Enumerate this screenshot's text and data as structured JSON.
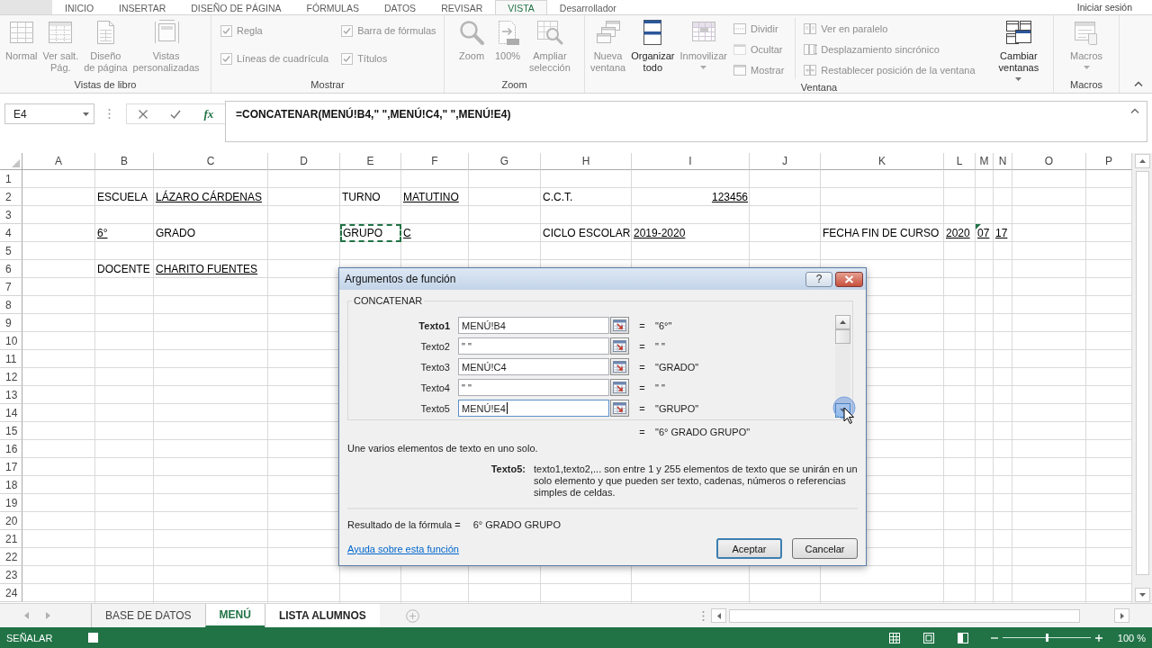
{
  "ribbon_tabs": [
    {
      "label": "INICIO",
      "selected": false
    },
    {
      "label": "INSERTAR",
      "selected": false
    },
    {
      "label": "DISEÑO DE PÁGINA",
      "selected": false
    },
    {
      "label": "FÓRMULAS",
      "selected": false
    },
    {
      "label": "DATOS",
      "selected": false
    },
    {
      "label": "REVISAR",
      "selected": false
    },
    {
      "label": "VISTA",
      "selected": true
    },
    {
      "label": "Desarrollador",
      "selected": false
    }
  ],
  "account": "Iniciar sesión",
  "ribbon_groups": [
    {
      "label": "Vistas de libro",
      "items": [
        {
          "kind": "large",
          "label": "Normal",
          "disabled": true,
          "dropdown": false
        },
        {
          "kind": "large",
          "label": "Ver salt.\nPág.",
          "disabled": true,
          "dropdown": false
        },
        {
          "kind": "large",
          "label": "Diseño\nde página",
          "disabled": true,
          "dropdown": false
        },
        {
          "kind": "large",
          "label": "Vistas\npersonalizadas",
          "disabled": true,
          "dropdown": false
        }
      ]
    },
    {
      "label": "Mostrar",
      "items": [
        {
          "kind": "stack",
          "items": [
            {
              "kind": "checkbox",
              "label": "Regla",
              "checked": true,
              "disabled": true
            },
            {
              "kind": "checkbox",
              "label": "Líneas de cuadrícula",
              "checked": true,
              "disabled": true
            }
          ]
        },
        {
          "kind": "stack",
          "items": [
            {
              "kind": "checkbox",
              "label": "Barra de fórmulas",
              "checked": true,
              "disabled": true
            },
            {
              "kind": "checkbox",
              "label": "Títulos",
              "checked": true,
              "disabled": true
            }
          ]
        }
      ]
    },
    {
      "label": "Zoom",
      "items": [
        {
          "kind": "large",
          "label": "Zoom",
          "disabled": true,
          "dropdown": false
        },
        {
          "kind": "large",
          "label": "100%",
          "disabled": true,
          "dropdown": false
        },
        {
          "kind": "large",
          "label": "Ampliar\nselección",
          "disabled": true,
          "dropdown": false
        }
      ]
    },
    {
      "label": "Ventana",
      "items": [
        {
          "kind": "large",
          "label": "Nueva\nventana",
          "disabled": true,
          "dropdown": false
        },
        {
          "kind": "large",
          "label": "Organizar\ntodo",
          "disabled": false,
          "dropdown": false
        },
        {
          "kind": "large",
          "label": "Inmovilizar",
          "disabled": true,
          "dropdown": true
        },
        {
          "kind": "stack",
          "items": [
            {
              "kind": "small",
              "label": "Dividir",
              "disabled": true
            },
            {
              "kind": "small",
              "label": "Ocultar",
              "disabled": true
            },
            {
              "kind": "small",
              "label": "Mostrar",
              "disabled": true
            }
          ]
        },
        {
          "kind": "stack",
          "items": [
            {
              "kind": "small",
              "label": "Ver en paralelo",
              "disabled": true
            },
            {
              "kind": "small",
              "label": "Desplazamiento sincrónico",
              "disabled": true
            },
            {
              "kind": "small",
              "label": "Restablecer posición de la ventana",
              "disabled": true
            }
          ]
        },
        {
          "kind": "large",
          "label": "Cambiar\nventanas",
          "disabled": false,
          "dropdown": true
        }
      ]
    },
    {
      "label": "Macros",
      "items": [
        {
          "kind": "large",
          "label": "Macros",
          "disabled": true,
          "dropdown": true
        }
      ]
    }
  ],
  "formula_bar": {
    "name_box": "E4",
    "insert_function": "fx",
    "formula": "=CONCATENAR(MENÚ!B4,\" \",MENÚ!C4,\" \",MENÚ!E4)"
  },
  "sheet": {
    "columns": [
      "A",
      "B",
      "C",
      "D",
      "E",
      "F",
      "G",
      "H",
      "I",
      "J",
      "K",
      "L",
      "M",
      "N",
      "O",
      "P"
    ],
    "rows": [
      {
        "number": "1"
      },
      {
        "number": "2",
        "cells": [
          {},
          {
            "kind": "text",
            "text": "ESCUELA",
            "underlined": false,
            "referenced": false,
            "flagged": false
          },
          {
            "kind": "text",
            "text": "LÁZARO CÁRDENAS",
            "underlined": true,
            "referenced": false,
            "flagged": false
          },
          {},
          {
            "kind": "text",
            "text": "TURNO",
            "underlined": false,
            "referenced": false,
            "flagged": false
          },
          {
            "kind": "text",
            "text": "MATUTINO",
            "underlined": true,
            "referenced": false,
            "flagged": false
          },
          {},
          {
            "kind": "text",
            "text": "C.C.T.",
            "underlined": false,
            "referenced": false,
            "flagged": false
          },
          {
            "kind": "number",
            "text": "123456",
            "underlined": true,
            "referenced": false,
            "flagged": false
          }
        ]
      },
      {
        "number": "3"
      },
      {
        "number": "4",
        "cells": [
          {},
          {
            "kind": "text",
            "text": "6°",
            "underlined": true,
            "referenced": false,
            "flagged": false
          },
          {
            "kind": "text",
            "text": "GRADO",
            "underlined": false,
            "referenced": false,
            "flagged": false
          },
          {},
          {
            "kind": "text",
            "text": "GRUPO",
            "underlined": false,
            "referenced": true,
            "flagged": false
          },
          {
            "kind": "text",
            "text": "C",
            "underlined": true,
            "referenced": false,
            "flagged": false
          },
          {},
          {
            "kind": "text",
            "text": "CICLO ESCOLAR",
            "underlined": false,
            "referenced": false,
            "flagged": false
          },
          {
            "kind": "text",
            "text": "2019-2020",
            "underlined": true,
            "referenced": false,
            "flagged": false
          },
          {},
          {
            "kind": "text",
            "text": "FECHA FIN DE CURSO",
            "underlined": false,
            "referenced": false,
            "flagged": false
          },
          {
            "kind": "text",
            "text": "2020",
            "underlined": true,
            "referenced": false,
            "flagged": false
          },
          {
            "kind": "text",
            "text": "07",
            "underlined": true,
            "referenced": false,
            "flagged": true
          },
          {
            "kind": "text",
            "text": "17",
            "underlined": true,
            "referenced": false,
            "flagged": false
          }
        ]
      },
      {
        "number": "5"
      },
      {
        "number": "6",
        "cells": [
          {},
          {
            "kind": "text",
            "text": "DOCENTE",
            "underlined": false,
            "referenced": false,
            "flagged": false
          },
          {
            "kind": "text",
            "text": "CHARITO FUENTES",
            "underlined": true,
            "referenced": false,
            "flagged": false
          }
        ]
      },
      {
        "number": "7"
      },
      {
        "number": "8"
      },
      {
        "number": "9"
      },
      {
        "number": "10"
      },
      {
        "number": "11"
      },
      {
        "number": "12"
      },
      {
        "number": "13"
      },
      {
        "number": "14"
      },
      {
        "number": "15"
      },
      {
        "number": "16"
      },
      {
        "number": "17"
      },
      {
        "number": "18"
      },
      {
        "number": "19"
      },
      {
        "number": "20"
      },
      {
        "number": "21"
      },
      {
        "number": "22"
      },
      {
        "number": "23"
      },
      {
        "number": "24"
      }
    ]
  },
  "sheet_tabs": [
    {
      "label": "BASE DE DATOS",
      "selected": false,
      "active": false
    },
    {
      "label": "MENÚ",
      "selected": true,
      "active": true
    },
    {
      "label": "LISTA ALUMNOS",
      "selected": true,
      "active": false
    }
  ],
  "status_bar": {
    "mode": "SEÑALAR",
    "zoom": {
      "level": 0.5,
      "reading": "100 %"
    }
  },
  "dialog": {
    "title": "Argumentos de función",
    "help_button": "?",
    "function_name": "CONCATENAR",
    "arguments": [
      {
        "label": "Texto1",
        "required": true,
        "value": "MENÚ!B4",
        "focused": false,
        "equals": "=",
        "result": "\"6°\""
      },
      {
        "label": "Texto2",
        "required": false,
        "value": "\" \"",
        "focused": false,
        "equals": "=",
        "result": "\" \""
      },
      {
        "label": "Texto3",
        "required": false,
        "value": "MENÚ!C4",
        "focused": false,
        "equals": "=",
        "result": "\"GRADO\""
      },
      {
        "label": "Texto4",
        "required": false,
        "value": "\" \"",
        "focused": false,
        "equals": "=",
        "result": "\" \""
      },
      {
        "label": "Texto5",
        "required": false,
        "value": "MENÚ!E4",
        "focused": true,
        "equals": "=",
        "result": "\"GRUPO\""
      }
    ],
    "final": {
      "equals": "=",
      "result": "\"6° GRADO GRUPO\""
    },
    "description": "Une varios elementos de texto en uno solo.",
    "argument_help": {
      "label": "Texto5:",
      "text": "texto1,texto2,... son entre 1 y 255 elementos de texto que se unirán en un solo elemento y que pueden ser texto, cadenas, números o referencias simples de celdas."
    },
    "formula_result": {
      "label": "Resultado de la fórmula =",
      "value": "6° GRADO GRUPO"
    },
    "help_link": "Ayuda sobre esta función",
    "buttons": [
      {
        "label": "Aceptar",
        "default": true
      },
      {
        "label": "Cancelar",
        "default": false
      }
    ]
  }
}
